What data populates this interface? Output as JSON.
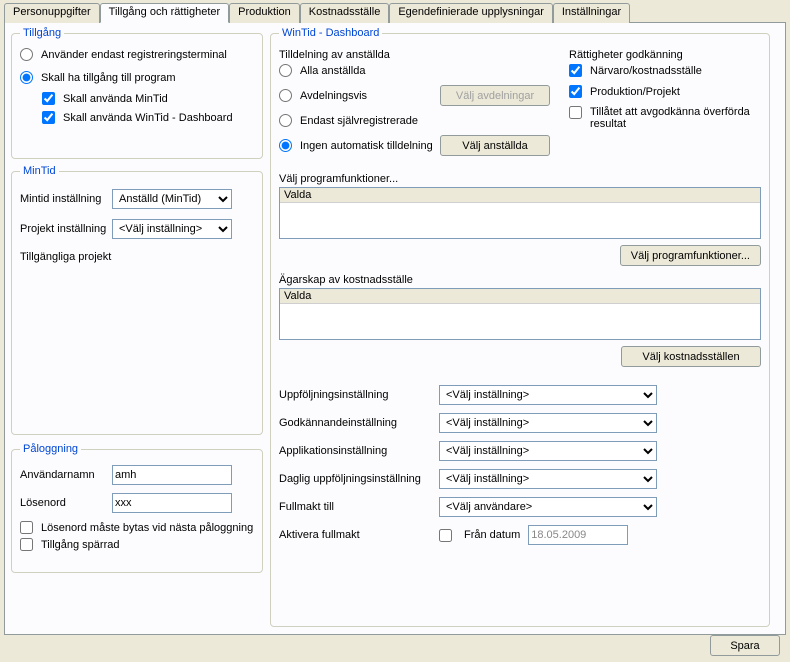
{
  "tabs": [
    "Personuppgifter",
    "Tillgång och rättigheter",
    "Produktion",
    "Kostnadsställe",
    "Egendefinierade upplysningar",
    "Inställningar"
  ],
  "tillgang": {
    "legend": "Tillgång",
    "opt_registrering": "Använder endast registreringsterminal",
    "opt_program": "Skall ha tillgång till program",
    "chk_mintid": "Skall använda MinTid",
    "chk_wintid": "Skall använda WinTid - Dashboard"
  },
  "mintid": {
    "legend": "MinTid",
    "lbl_mintid": "Mintid inställning",
    "sel_mintid": "Anställd (MinTid)",
    "lbl_projekt": "Projekt inställning",
    "sel_projekt": "<Välj inställning>",
    "lbl_tillgangliga": "Tillgängliga projekt"
  },
  "paloggning": {
    "legend": "Påloggning",
    "lbl_user": "Användarnamn",
    "val_user": "amh",
    "lbl_pass": "Lösenord",
    "val_pass": "xxx",
    "chk_mustchange": "Lösenord måste bytas vid nästa påloggning",
    "chk_sparrad": "Tillgång spärrad"
  },
  "wintid": {
    "legend": "WinTid - Dashboard",
    "lbl_tilldelning": "Tilldelning av anställda",
    "opt_alla": "Alla anställda",
    "opt_avdelning": "Avdelningsvis",
    "btn_valj_avd": "Välj avdelningar",
    "opt_sjalv": "Endast självregistrerade",
    "opt_ingen": "Ingen automatisk tilldelning",
    "btn_valj_anst": "Välj anställda",
    "lbl_rattigheter": "Rättigheter godkänning",
    "chk_narvaro": "Närvaro/kostnadsställe",
    "chk_produktion": "Produktion/Projekt",
    "chk_tillatet": "Tillåtet att avgodkänna överförda resultat",
    "lbl_programfunk": "Välj programfunktioner...",
    "list_valda": "Valda",
    "btn_programfunk": "Välj programfunktioner...",
    "lbl_agarskap": "Ägarskap av kostnadsställe",
    "btn_kostnad": "Välj kostnadsställen",
    "form": {
      "lbl_uppfolj": "Uppföljningsinställning",
      "lbl_godkann": "Godkännandeinställning",
      "lbl_applik": "Applikationsinställning",
      "lbl_daglig": "Daglig uppföljningsinställning",
      "lbl_fullmakt": "Fullmakt till",
      "lbl_aktivera": "Aktivera fullmakt",
      "lbl_fran": "Från datum",
      "sel_default": "<Välj inställning>",
      "sel_anvandare": "<Välj användare>",
      "date": "18.05.2009"
    }
  },
  "save": "Spara"
}
